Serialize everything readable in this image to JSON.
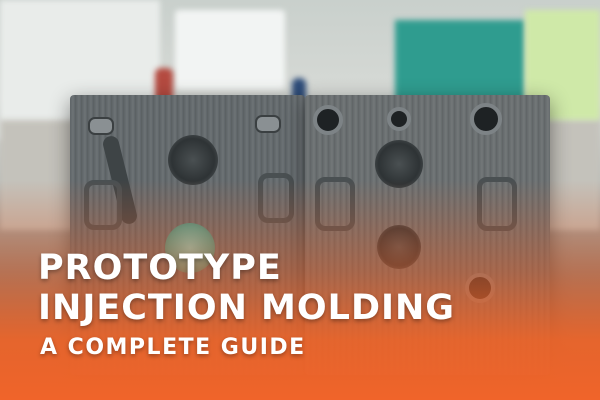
{
  "banner": {
    "title_line_1": "PROTOTYPE",
    "title_line_2": "INJECTION MOLDING",
    "subtitle": "A COMPLETE GUIDE"
  },
  "colors": {
    "accent_orange": "#f0642a",
    "text": "#ffffff",
    "mold_steel": "#656a6c"
  }
}
